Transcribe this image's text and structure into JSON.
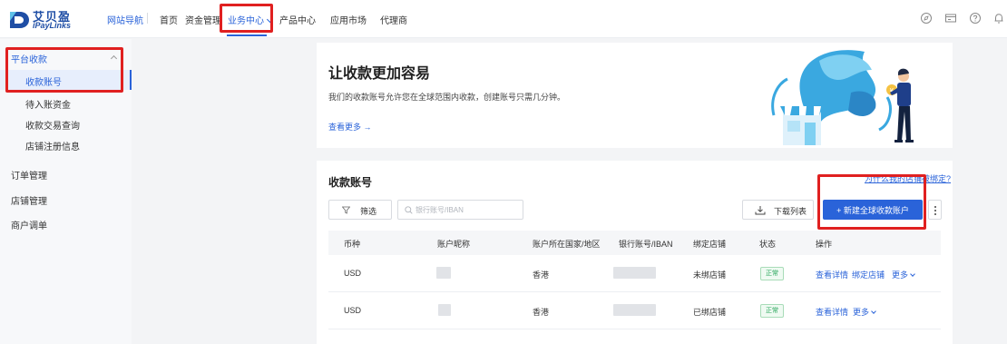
{
  "brand": {
    "name": "艾贝盈",
    "sub": "iPayLinks"
  },
  "topnav": {
    "site_nav": "网站导航",
    "items": [
      "首页",
      "资金管理",
      "业务中心",
      "产品中心",
      "应用市场",
      "代理商"
    ],
    "active": "业务中心",
    "icons": [
      "compass-icon",
      "card-icon",
      "help-icon",
      "bell-icon"
    ]
  },
  "sidebar": {
    "group": "平台收款",
    "items": [
      "收款账号",
      "待入账资金",
      "收款交易查询",
      "店铺注册信息"
    ],
    "active": "收款账号",
    "top_items": [
      "订单管理",
      "店铺管理",
      "商户调单"
    ]
  },
  "banner": {
    "title": "让收款更加容易",
    "desc": "我们的收款账号允许您在全球范围内收款，创建账号只需几分钟。",
    "more": "查看更多 →"
  },
  "accounts": {
    "title": "收款账号",
    "link": "为什么我的店铺被绑定?",
    "filter_label": "筛选",
    "search_placeholder": "银行账号/IBAN",
    "download_label": "下载列表",
    "new_label": "+ 新建全球收款账户",
    "columns": [
      "币种",
      "账户昵称",
      "账户所在国家/地区",
      "银行账号/IBAN",
      "绑定店铺",
      "状态",
      "操作"
    ],
    "rows": [
      {
        "currency": "USD",
        "region": "香港",
        "store": "未绑店铺",
        "status": "正常",
        "actions": [
          "查看详情",
          "绑定店铺",
          "更多"
        ]
      },
      {
        "currency": "USD",
        "region": "香港",
        "store": "已绑店铺",
        "status": "正常",
        "actions": [
          "查看详情",
          "更多"
        ]
      }
    ]
  },
  "colors": {
    "accent": "#2a63d9",
    "highlight": "#e02020",
    "status_ok": "#27a55a"
  }
}
